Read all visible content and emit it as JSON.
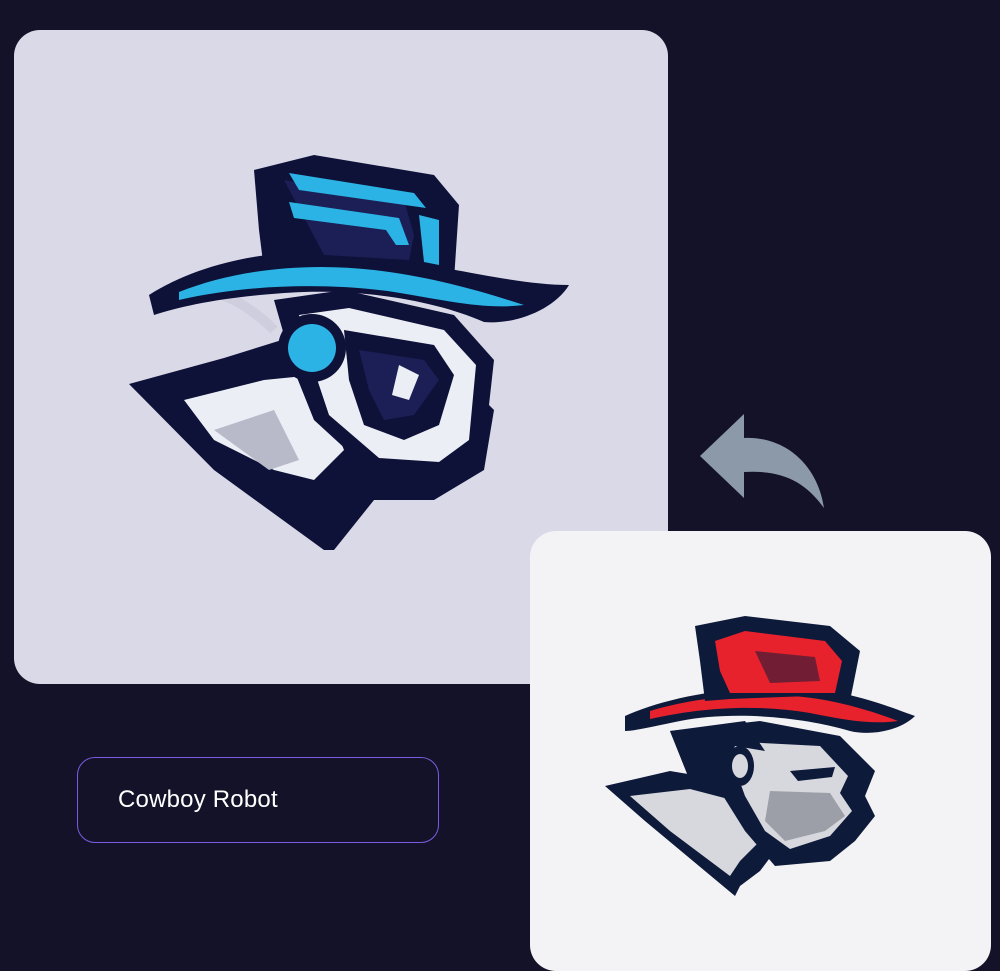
{
  "prompt": {
    "value": "Cowboy Robot"
  },
  "images": {
    "generated": {
      "icon": "cowboy-robot-mascot-logo",
      "background": "#dad9e8",
      "accent": "#2ab3e4",
      "outline": "#0e1138"
    },
    "original": {
      "icon": "cowboy-man-mascot-logo",
      "background": "#f3f3f5",
      "accent": "#e8222c",
      "outline": "#0e1a3a"
    }
  },
  "arrow": {
    "icon": "curved-undo-arrow-icon",
    "color": "#8c99a9"
  },
  "theme": {
    "background": "#141228",
    "input_border": "#7b5ce0",
    "input_text": "#ffffff"
  }
}
